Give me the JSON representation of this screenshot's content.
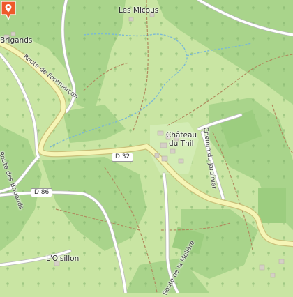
{
  "map": {
    "places": {
      "les_micous": "Les Micous",
      "brigands_top": "Brigands",
      "chateau_line1": "Château",
      "chateau_line2": "du Thil",
      "loisillon": "L'Oisillon"
    },
    "roads": {
      "route_fontmarcon": "Route de Fontmarçon",
      "route_brigands": "Route des Brigands",
      "chemin_jardinier": "Chemin du Jardinier",
      "route_moliere": "Route de la Molière"
    },
    "shields": {
      "d32": "D 32",
      "d86": "D 86"
    },
    "colors": {
      "meadow": "#c9e5a3",
      "forest": "#a9d48b",
      "main_road": "#f6f5b6",
      "main_road_casing": "#c9c07a",
      "water": "#7ab8d6",
      "marker": "#ee5a2a"
    },
    "marker_icon": "map-pin-icon"
  }
}
